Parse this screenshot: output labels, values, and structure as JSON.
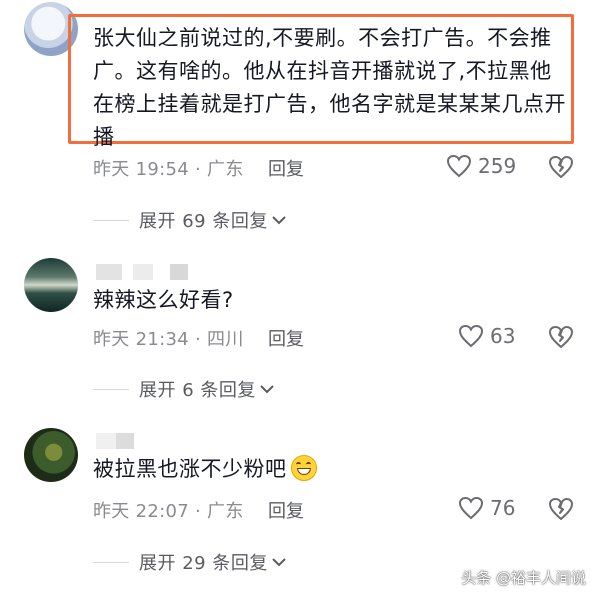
{
  "comments": [
    {
      "text": "张大仙之前说过的,不要刷。不会打广告。不会推广。这有啥的。他从在抖音开播就说了,不拉黑他在榜上挂着就是打广告，他名字就是某某某几点开播",
      "time_loc": "昨天 19:54 · 广东",
      "reply_label": "回复",
      "likes": "259",
      "expand_label": "展开 69 条回复"
    },
    {
      "text": "辣辣这么好看?",
      "time_loc": "昨天 21:34 · 四川",
      "reply_label": "回复",
      "likes": "63",
      "expand_label": "展开 6 条回复"
    },
    {
      "text": "被拉黑也涨不少粉吧",
      "time_loc": "昨天 22:07 · 广东",
      "reply_label": "回复",
      "likes": "76",
      "expand_label": "展开 29 条回复"
    }
  ],
  "watermark": "头条 @裕丰人间说",
  "colors": {
    "highlight_border": "#f06f3a",
    "meta": "#8a8b91",
    "text": "#161823"
  },
  "icons": [
    "heart-icon",
    "broken-heart-icon",
    "chevron-down-icon",
    "grin-emoji"
  ]
}
